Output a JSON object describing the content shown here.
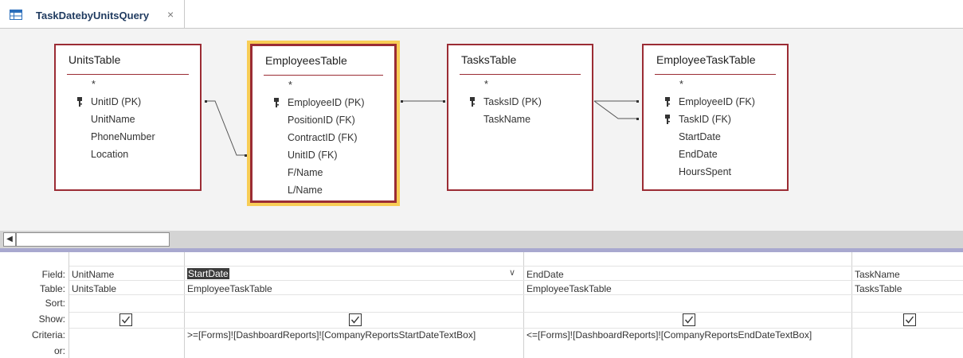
{
  "tab": {
    "title": "TaskDatebyUnitsQuery",
    "close_glyph": "×",
    "icon": "query-icon"
  },
  "tables": [
    {
      "title": "UnitsTable",
      "star": "*",
      "fields": [
        "UnitID (PK)",
        "UnitName",
        "PhoneNumber",
        "Location"
      ],
      "keys": [
        true,
        false,
        false,
        false
      ],
      "selected": false
    },
    {
      "title": "EmployeesTable",
      "star": "*",
      "fields": [
        "EmployeeID (PK)",
        "PositionID (FK)",
        "ContractID (FK)",
        "UnitID (FK)",
        "F/Name",
        "L/Name"
      ],
      "keys": [
        true,
        false,
        false,
        false,
        false,
        false
      ],
      "selected": true
    },
    {
      "title": "TasksTable",
      "star": "*",
      "fields": [
        "TasksID (PK)",
        "TaskName"
      ],
      "keys": [
        true,
        false
      ],
      "selected": false
    },
    {
      "title": "EmployeeTaskTable",
      "star": "*",
      "fields": [
        "EmployeeID (FK)",
        "TaskID (FK)",
        "StartDate",
        "EndDate",
        "HoursSpent"
      ],
      "keys": [
        true,
        true,
        false,
        false,
        false
      ],
      "selected": false
    }
  ],
  "grid": {
    "row_labels": {
      "field": "Field:",
      "table": "Table:",
      "sort": "Sort:",
      "show": "Show:",
      "criteria": "Criteria:",
      "or": "or:"
    },
    "columns": [
      {
        "field": "UnitName",
        "table": "UnitsTable",
        "sort": "",
        "show": true,
        "criteria": "",
        "or": ""
      },
      {
        "field": "StartDate",
        "table": "EmployeeTaskTable",
        "sort": "",
        "show": true,
        "criteria": ">=[Forms]![DashboardReports]![CompanyReportsStartDateTextBox]",
        "or": ""
      },
      {
        "field": "EndDate",
        "table": "EmployeeTaskTable",
        "sort": "",
        "show": true,
        "criteria": "<=[Forms]![DashboardReports]![CompanyReportsEndDateTextBox]",
        "or": ""
      },
      {
        "field": "TaskName",
        "table": "TasksTable",
        "sort": "",
        "show": true,
        "criteria": "",
        "or": ""
      }
    ],
    "dropdown_glyph": "∨"
  },
  "scroll": {
    "left_arrow": "◀"
  },
  "colors": {
    "table_border": "#9b2c34",
    "selection_highlight": "#f8cd56",
    "field_selection": "#3c3c3c",
    "splitter": "#a8a8cf"
  }
}
